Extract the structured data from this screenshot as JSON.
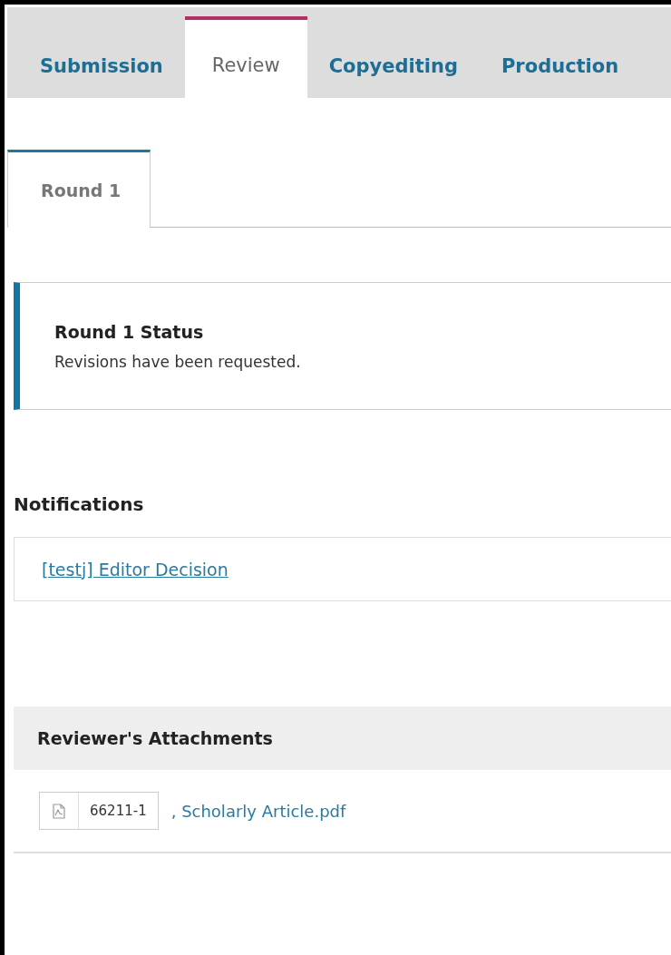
{
  "stage_tabs": [
    {
      "label": "Submission",
      "selected": false
    },
    {
      "label": "Review",
      "selected": true
    },
    {
      "label": "Copyediting",
      "selected": false
    },
    {
      "label": "Production",
      "selected": false
    }
  ],
  "round_tabs": [
    {
      "label": "Round 1",
      "selected": true
    }
  ],
  "status": {
    "title": "Round 1 Status",
    "message": "Revisions have been requested."
  },
  "notifications": {
    "heading": "Notifications",
    "items": [
      "[testj] Editor Decision"
    ]
  },
  "attachments": {
    "heading": "Reviewer's Attachments",
    "files": [
      {
        "id": "66211-1",
        "name": ", Scholarly Article.pdf"
      }
    ]
  }
}
